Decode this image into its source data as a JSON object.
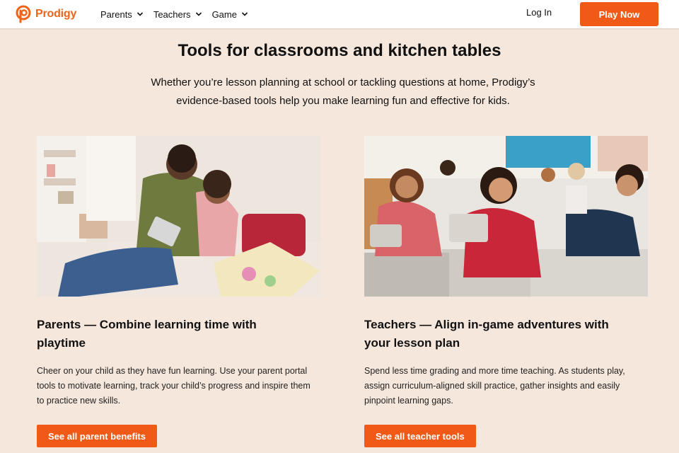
{
  "brand": {
    "name": "Prodigy",
    "accent": "#f15a16"
  },
  "nav": {
    "items": [
      {
        "label": "Parents",
        "icon": "chevron-down-icon"
      },
      {
        "label": "Teachers",
        "icon": "chevron-down-icon"
      },
      {
        "label": "Game",
        "icon": "chevron-down-icon"
      }
    ],
    "login_label": "Log In",
    "play_label": "Play Now"
  },
  "hero": {
    "title": "Tools for classrooms and kitchen tables",
    "intro": "Whether you’re lesson planning at school or tackling questions at home, Prodigy’s evidence-based tools help you make learning fun and effective for kids."
  },
  "cards": [
    {
      "title": "Parents — Combine learning time with playtime",
      "body": "Cheer on your child as they have fun learning. Use your parent portal tools to motivate learning, track your child’s progress and inspire them to practice new skills.",
      "button": "See all parent benefits"
    },
    {
      "title": "Teachers — Align in-game adventures with your lesson plan",
      "body": "Spend less time grading and more time teaching. As students play, assign curriculum-aligned skill practice, gather insights and easily pinpoint learning gaps.",
      "button": "See all teacher tools"
    }
  ]
}
